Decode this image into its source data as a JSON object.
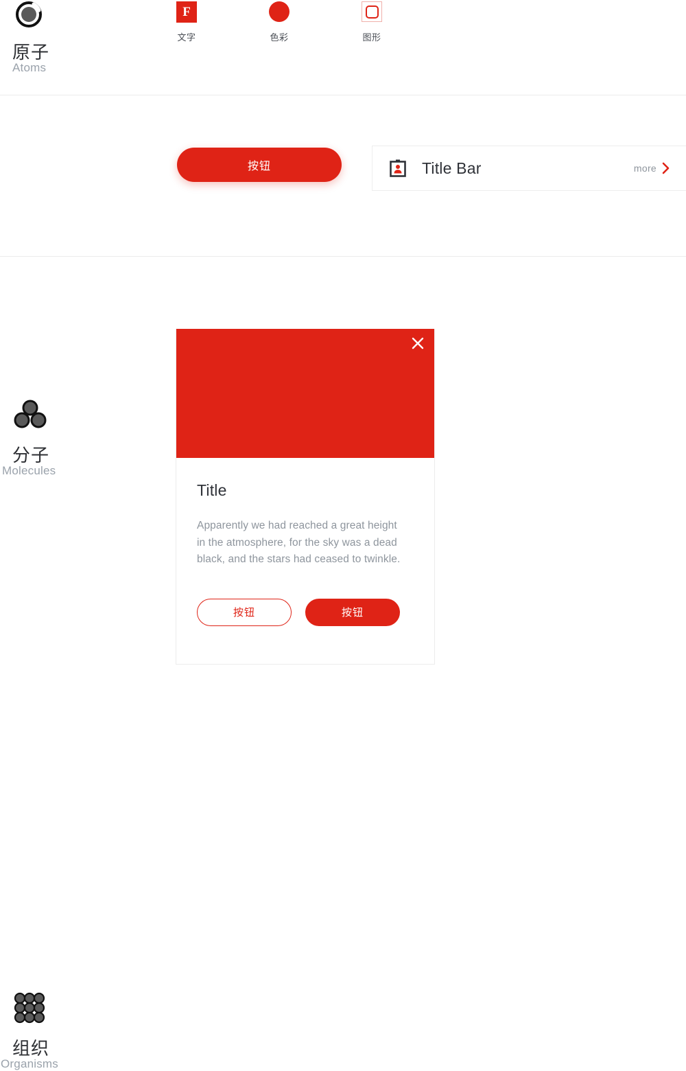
{
  "theme": {
    "accent": "#DF2316",
    "accent_soft": "#F0B0AA",
    "text_dark": "#2F3238",
    "text_muted": "#8E959D",
    "divider": "#ECECEC",
    "icon_dark": "#5A5A5A"
  },
  "levels": [
    {
      "id": "atoms",
      "cn": "原子",
      "en": "Atoms",
      "icon": "atom-circle-icon"
    },
    {
      "id": "molecules",
      "cn": "分子",
      "en": "Molecules",
      "icon": "molecule-triple-circle-icon"
    },
    {
      "id": "organisms",
      "cn": "组织",
      "en": "Organisms",
      "icon": "organism-circle-grid-icon"
    }
  ],
  "atoms": {
    "items": [
      {
        "id": "text",
        "label": "文字",
        "icon": "letter-f-swatch-icon",
        "glyph": "F"
      },
      {
        "id": "color",
        "label": "色彩",
        "icon": "color-circle-swatch-icon"
      },
      {
        "id": "shape",
        "label": "图形",
        "icon": "rounded-square-swatch-icon"
      }
    ]
  },
  "molecules": {
    "button": {
      "label": "按钮"
    },
    "title_bar": {
      "icon": "id-badge-icon",
      "title": "Title Bar",
      "more_label": "more",
      "more_icon": "chevron-right-icon"
    }
  },
  "organisms": {
    "card": {
      "close_icon": "close-icon",
      "title": "Title",
      "body": "Apparently we had reached a great height in the atmosphere, for the sky was a dead black, and the stars had ceased to twinkle.",
      "buttons": [
        {
          "id": "secondary",
          "label": "按钮",
          "style": "outline"
        },
        {
          "id": "primary",
          "label": "按钮",
          "style": "filled"
        }
      ]
    }
  }
}
